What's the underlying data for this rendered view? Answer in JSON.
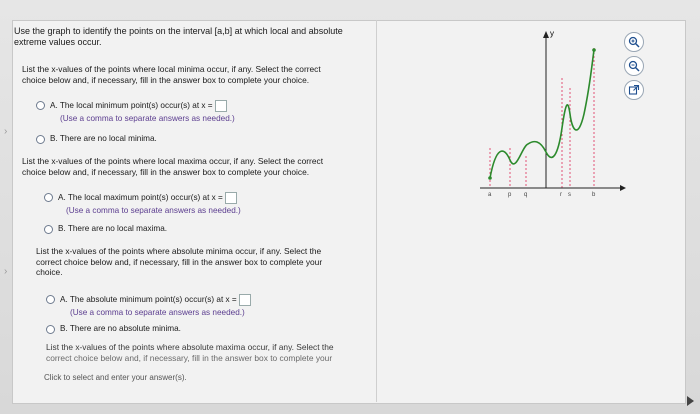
{
  "question": {
    "line1": "Use the graph to identify the points on the interval [a,b] at which local and absolute",
    "line2": "extreme values occur."
  },
  "sections": [
    {
      "prompt_l1": "List the x-values of the points where local minima occur, if any. Select the correct",
      "prompt_l2": "choice below and, if necessary, fill in the answer box to complete your choice.",
      "optA": "The local minimum point(s) occur(s) at x =",
      "hint": "(Use a comma to separate answers as needed.)",
      "optB": "There are no local minima."
    },
    {
      "prompt_l1": "List the x-values of the points where local maxima occur, if any. Select the correct",
      "prompt_l2": "choice below and, if necessary, fill in the answer box to complete your choice.",
      "optA": "The local maximum point(s) occur(s) at x =",
      "hint": "(Use a comma to separate answers as needed.)",
      "optB": "There are no local maxima."
    },
    {
      "prompt_l1": "List the x-values of the points where absolute minima occur, if any. Select the",
      "prompt_l2": "correct choice below and, if necessary, fill in the answer box to complete your",
      "prompt_l3": "choice.",
      "optA": "The absolute minimum point(s) occur(s) at x =",
      "hint": "(Use a comma to separate answers as needed.)",
      "optB": "There are no absolute minima."
    },
    {
      "prompt_l1": "List the x-values of the points where absolute maxima occur, if any. Select the",
      "prompt_l2": "correct choice below and, if necessary, fill in the answer box to complete your"
    }
  ],
  "footer": "Click to select and enter your answer(s).",
  "graph": {
    "axis_y": "y",
    "labels": [
      "a",
      "p",
      "q",
      "r",
      "s",
      "b"
    ]
  },
  "icons": {
    "zoom_in": "zoom-in-icon",
    "zoom_out": "zoom-out-icon",
    "popout": "popout-icon"
  }
}
